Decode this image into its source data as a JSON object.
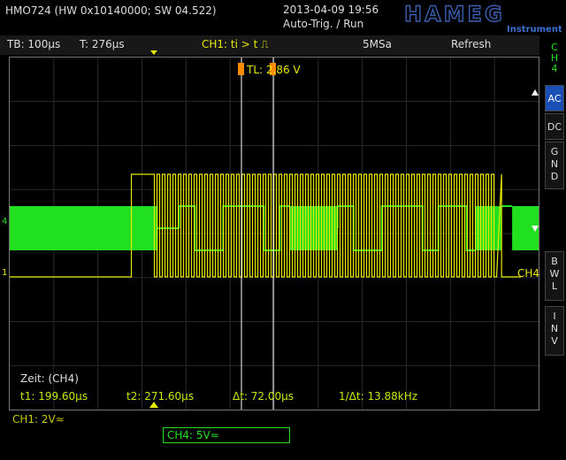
{
  "header": {
    "model": "HMO724 (HW 0x10140000; SW 04.522)",
    "datetime": "2013-04-09 19:56",
    "trigger_mode": "Auto-Trig. / Run",
    "brand": "HAMEG",
    "brand_sub": "Instruments"
  },
  "infobar": {
    "timebase": "TB: 100µs",
    "trigger_time": "T: 276µs",
    "trigger": "CH1: ti > t ⎍",
    "sample_rate": "5MSa",
    "mode": "Refresh"
  },
  "plot": {
    "trigger_level": "TL: 2.86 V",
    "ch4_marker": "4",
    "ch1_marker": "1",
    "ch4_trace_label": "CH4",
    "cursor_panel": {
      "source": "Zeit: (CH4)",
      "t1": "t1: 199.60µs",
      "t2": "t2: 271.60µs",
      "dt": "Δt: 72.00µs",
      "inv_dt": "1/Δt: 13.88kHz"
    }
  },
  "side_menu": {
    "channel": [
      "C",
      "H",
      "4"
    ],
    "ac": "AC",
    "dc": "DC",
    "gnd": [
      "G",
      "N",
      "D"
    ],
    "bwl": [
      "B",
      "W",
      "L"
    ],
    "inv": [
      "I",
      "N",
      "V"
    ]
  },
  "bottom": {
    "ch1_scale": "CH1: 2V≈",
    "ch4_scale": "CH4: 5V≈"
  },
  "colors": {
    "ch1": "#e8e800",
    "ch4": "#20e020",
    "cursor": "#ffffff",
    "accent": "#1a4fb5",
    "trigger_marker": "#ff8c00"
  },
  "waveforms": {
    "ch4_segments": [
      {
        "kind": "dense",
        "t0": 0.0,
        "t1": 0.28
      },
      {
        "kind": "low",
        "t0": 0.28,
        "t1": 0.32
      },
      {
        "kind": "bits",
        "t0": 0.32,
        "t1": 0.53
      },
      {
        "kind": "dense",
        "t0": 0.53,
        "t1": 0.62
      },
      {
        "kind": "bits",
        "t0": 0.62,
        "t1": 0.88
      },
      {
        "kind": "dense",
        "t0": 0.88,
        "t1": 0.93
      },
      {
        "kind": "gap",
        "t0": 0.93,
        "t1": 0.95
      },
      {
        "kind": "dense",
        "t0": 0.95,
        "t1": 1.0
      }
    ],
    "ch1_active": [
      {
        "t0": 0.23,
        "t1": 0.93
      }
    ]
  }
}
